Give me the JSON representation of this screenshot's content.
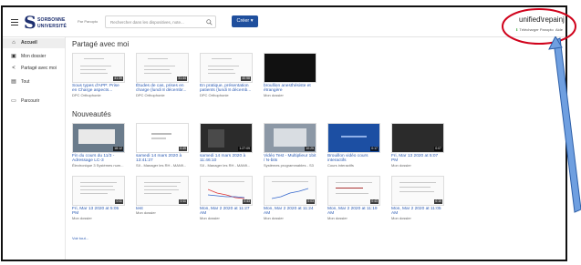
{
  "topbar": {
    "logo_line1": "SORBONNE",
    "logo_line2": "UNIVERSITÉ",
    "brand": "Par Panopto",
    "search_placeholder": "Rechercher dans les dispositives, note...",
    "create_label": "Créer",
    "user_name": "unified\\repainj",
    "download_label": "Télécharger Panopto",
    "help_label": "Aide"
  },
  "sidebar": {
    "items": [
      {
        "label": "Accueil",
        "icon": "home-icon"
      },
      {
        "label": "Mon dossier",
        "icon": "folder-icon"
      },
      {
        "label": "Partagé avec moi",
        "icon": "share-icon"
      },
      {
        "label": "Tout",
        "icon": "grid-icon"
      },
      {
        "label": "Parcourir",
        "icon": "folder-outline-icon"
      }
    ]
  },
  "shared": {
    "title": "Partagé avec moi",
    "cards": [
      {
        "title": "Sous types d'APP: Prise en Charge aspects...",
        "sub": "DPC Orthophonie",
        "duration": "41:39"
      },
      {
        "title": "Études de cas, prises en charge (lundi 8 décembr...",
        "sub": "DPC Orthophonie",
        "duration": "31:44"
      },
      {
        "title": "En pratique, présentation patients (lundi 8 décemb...",
        "sub": "DPC Orthophonie",
        "duration": "40:58"
      },
      {
        "title": "broullion anesthésiste et étrangère",
        "sub": "Mon dossier",
        "duration": ""
      }
    ]
  },
  "news": {
    "title": "Nouveautés",
    "row1": [
      {
        "title": "Fin du cours du 11/3 - Adressage LC-3",
        "sub": "Électronique 3 Systèmes num...",
        "duration": "18:12"
      },
      {
        "title": "samedi 14 mars 2020 à 13:41:27",
        "sub": "SII - Manager les RH - MAN9...",
        "duration": "0:49"
      },
      {
        "title": "samedi 14 mars 2020 à 11:46:10",
        "sub": "SII - Manager les RH - MAN9...",
        "duration": "1:27:09"
      },
      {
        "title": "Vidéo Test - Multiplieur 1bit / N-bits",
        "sub": "Systèmes programmables - S3",
        "duration": "10:25"
      },
      {
        "title": "Brouillon vidéo cours interactifs",
        "sub": "Cours interactifs",
        "duration": "0:17"
      },
      {
        "title": "Fri, Mar 13 2020 at 5:07 PM",
        "sub": "Mon dossier",
        "duration": "0:07"
      }
    ],
    "row2": [
      {
        "title": "Fri, Mar 13 2020 at 5:05 PM",
        "sub": "Mon dossier",
        "duration": "0:11"
      },
      {
        "title": "test",
        "sub": "Mon dossier",
        "duration": "0:11"
      },
      {
        "title": "Mon, Mar 2 2020 at 11:27 AM",
        "sub": "Mon dossier",
        "duration": "0:43"
      },
      {
        "title": "Mon, Mar 2 2020 at 11:24 AM",
        "sub": "Mon dossier",
        "duration": "0:03"
      },
      {
        "title": "Mon, Mar 2 2020 at 11:19 AM",
        "sub": "Mon dossier",
        "duration": "0:43"
      },
      {
        "title": "Mon, Mar 2 2020 at 11:05 AM",
        "sub": "Mon dossier",
        "duration": "0:10"
      }
    ],
    "see_more": "Voir tout..."
  },
  "colors": {
    "accent": "#1f4f9d",
    "link": "#2c5bb3",
    "annotation_red": "#d0021b",
    "annotation_blue": "#5b8ed6"
  }
}
